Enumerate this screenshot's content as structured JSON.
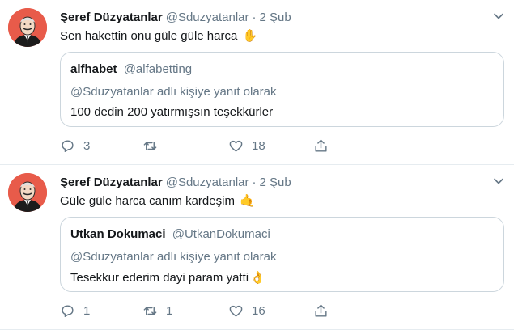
{
  "tweets": [
    {
      "author_name": "Şeref Düzyatanlar",
      "author_handle": "@Sduzyatanlar",
      "separator": "·",
      "date": "2 Şub",
      "text": "Sen hakettin onu güle güle harca",
      "emoji": "✋",
      "quote": {
        "name": "alfhabet",
        "handle": "@alfabetting",
        "reply_to": "@Sduzyatanlar adlı kişiye yanıt olarak",
        "text": "100 dedin 200 yatırmışsın teşekkürler",
        "emoji": ""
      },
      "actions": {
        "replies": "3",
        "retweets": "",
        "likes": "18"
      }
    },
    {
      "author_name": "Şeref Düzyatanlar",
      "author_handle": "@Sduzyatanlar",
      "separator": "·",
      "date": "2 Şub",
      "text": "Güle güle harca canım kardeşim",
      "emoji": "🤙",
      "quote": {
        "name": "Utkan Dokumaci",
        "handle": "@UtkanDokumaci",
        "reply_to": "@Sduzyatanlar adlı kişiye yanıt olarak",
        "text": "Tesekkur ederim dayi param yatti",
        "emoji": "👌"
      },
      "actions": {
        "replies": "1",
        "retweets": "1",
        "likes": "16"
      }
    }
  ],
  "icons": {
    "reply": "speech-bubble-icon",
    "retweet": "retweet-arrows-icon",
    "like": "heart-outline-icon",
    "share": "share-arrow-up-icon",
    "menu": "chevron-down-icon"
  },
  "colors": {
    "text_primary": "#14171a",
    "text_secondary": "#657786",
    "border": "#ccd6dd",
    "avatar_bg": "#e85b4a"
  }
}
